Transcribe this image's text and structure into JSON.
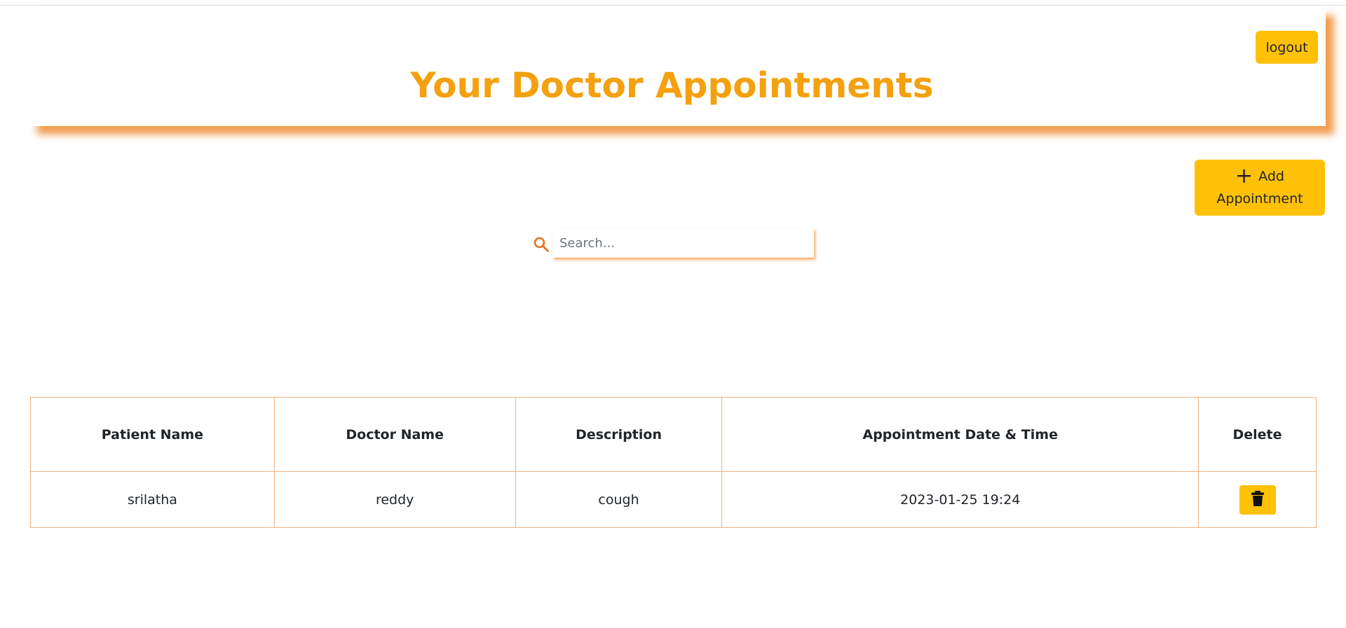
{
  "header": {
    "title": "Your Doctor Appointments",
    "logout_label": "logout"
  },
  "toolbar": {
    "add_label_line1": "Add",
    "add_label_line2": "Appointment"
  },
  "search": {
    "placeholder": "Search...",
    "value": ""
  },
  "table": {
    "columns": [
      "Patient Name",
      "Doctor Name",
      "Description",
      "Appointment Date & Time",
      "Delete"
    ],
    "rows": [
      {
        "patient": "srilatha",
        "doctor": "reddy",
        "description": "cough",
        "datetime": "2023-01-25 19:24"
      }
    ]
  },
  "icons": {
    "search": "search-icon",
    "add": "plus-icon",
    "delete": "trash-icon"
  },
  "colors": {
    "accent": "#ffc107",
    "title": "#f5a00f",
    "shadow": "#f08c32",
    "table_border": "#f5b27a"
  }
}
